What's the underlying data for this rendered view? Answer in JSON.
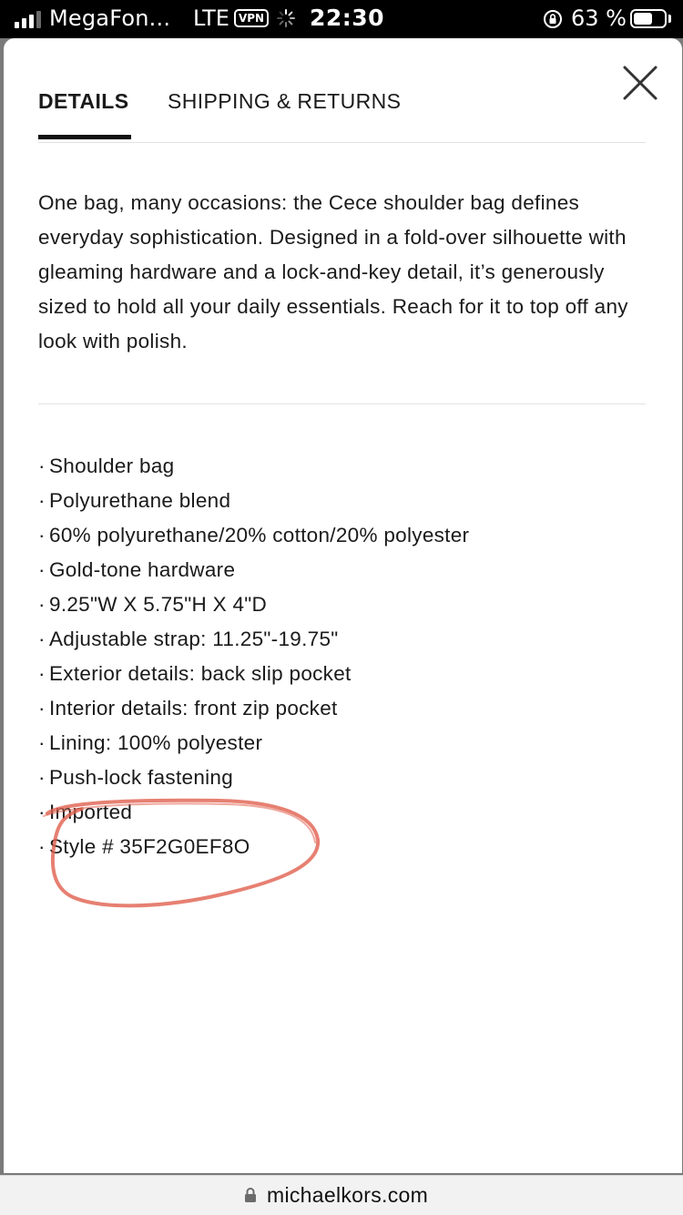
{
  "status_bar": {
    "carrier": "MegaFon...",
    "network": "LTE",
    "vpn": "VPN",
    "time": "22:30",
    "battery_percent": "63 %",
    "battery_level": 0.63,
    "signal_bars": 3,
    "signal_bars_total": 4
  },
  "modal": {
    "tabs": [
      {
        "label": "DETAILS",
        "active": true
      },
      {
        "label": "SHIPPING & RETURNS",
        "active": false
      }
    ],
    "description": "One bag, many occasions: the Cece shoulder bag defines everyday sophistication. Designed in a fold-over silhouette with gleaming hardware and a lock-and-key detail, it’s generously sized to hold all your daily essentials. Reach for it to top off any look with polish.",
    "bullet": "·",
    "features": [
      "Shoulder bag",
      "Polyurethane blend",
      "60% polyurethane/20% cotton/20% polyester",
      "Gold-tone hardware",
      "9.25\"W X 5.75\"H X 4\"D",
      "Adjustable strap: 11.25\"-19.75\"",
      "Exterior details: back slip pocket",
      "Interior details: front zip pocket",
      "Lining: 100% polyester",
      "Push-lock fastening",
      "Imported",
      "Style # 35F2G0EF8O"
    ]
  },
  "url_bar": {
    "domain": "michaelkors.com"
  },
  "colors": {
    "annotation_circle": "#e0604f",
    "divider": "#e2e2e2",
    "text": "#1a1a1a"
  },
  "icons": {
    "close": "close-icon",
    "lock": "lock-icon",
    "rotation_lock": "rotation-lock-icon",
    "activity_spinner": "loading-spinner-icon"
  }
}
